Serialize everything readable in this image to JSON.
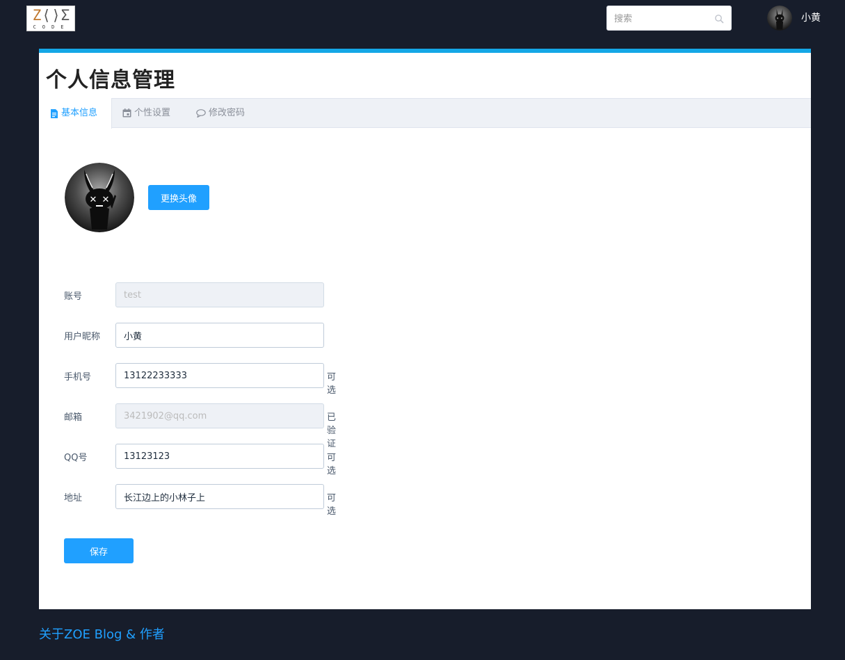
{
  "header": {
    "logo_main": "ZOE",
    "logo_sub": "CODE",
    "search_placeholder": "搜索",
    "username": "小黄"
  },
  "page": {
    "title": "个人信息管理",
    "tabs": [
      {
        "label": "基本信息",
        "icon": "document-icon",
        "active": true
      },
      {
        "label": "个性设置",
        "icon": "calendar-icon",
        "active": false
      },
      {
        "label": "修改密码",
        "icon": "chat-bubble-icon",
        "active": false
      }
    ]
  },
  "avatar": {
    "change_button": "更换头像"
  },
  "form": {
    "account": {
      "label": "账号",
      "value": "test",
      "disabled": true
    },
    "nickname": {
      "label": "用户昵称",
      "value": "小黄"
    },
    "phone": {
      "label": "手机号",
      "value": "13122233333",
      "hint": "可选"
    },
    "email": {
      "label": "邮箱",
      "value": "3421902@qq.com",
      "hint": "已验证",
      "disabled": true
    },
    "qq": {
      "label": "QQ号",
      "value": "13123123",
      "hint": "可选"
    },
    "address": {
      "label": "地址",
      "value": "长江边上的小林子上",
      "hint": "可选"
    },
    "save_button": "保存"
  },
  "footer": {
    "link": "关于ZOE Blog & 作者"
  },
  "colors": {
    "background": "#171d2b",
    "accent": "#14a7e6",
    "primary_button": "#20a0ff"
  }
}
